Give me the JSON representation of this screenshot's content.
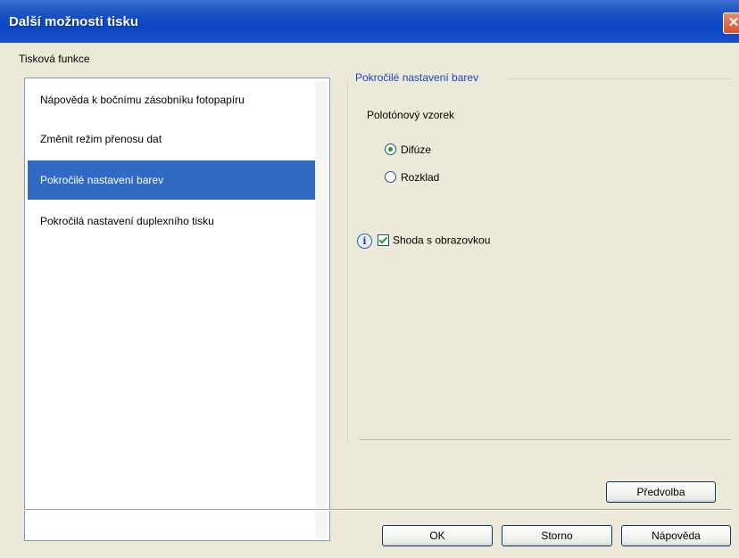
{
  "window": {
    "title": "Další možnosti tisku"
  },
  "feature_group": {
    "label": "Tisková funkce"
  },
  "features": [
    {
      "label": "Nápověda k bočnímu zásobníku fotopapíru"
    },
    {
      "label": "Změnit režim přenosu dat"
    },
    {
      "label": "Pokročilé nastavení barev",
      "selected": true
    },
    {
      "label": "Pokročilá nastavení duplexního tisku"
    }
  ],
  "color_settings": {
    "section_title": "Pokročilé nastavení barev",
    "halftone_label": "Polotónový vzorek",
    "options": [
      {
        "label": "Difúze",
        "checked": true
      },
      {
        "label": "Rozklad",
        "checked": false
      }
    ],
    "match_screen_label": "Shoda s obrazovkou",
    "match_screen_checked": true
  },
  "buttons": {
    "preset": "Předvolba",
    "ok": "OK",
    "cancel": "Storno",
    "help": "Nápověda"
  },
  "colors": {
    "title_bar": "#0a45c4",
    "selection": "#316ac5",
    "section_title": "#1a44c8",
    "radio_check": "#21a121"
  },
  "icons": {
    "close": "close-icon",
    "info": "info-icon"
  }
}
